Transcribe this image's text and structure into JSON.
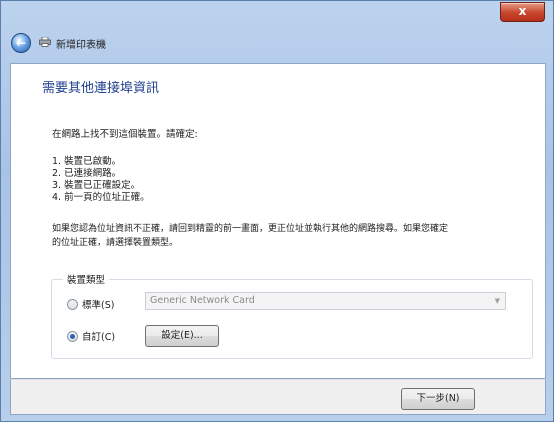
{
  "window": {
    "close_label": "x",
    "title": "新增印表機"
  },
  "main": {
    "heading": "需要其他連接埠資訊",
    "intro": "在網路上找不到這個裝置。請確定:",
    "checklist": [
      "1. 裝置已啟動。",
      "2. 已連接網路。",
      "3. 裝置已正確設定。",
      "4. 前一頁的位址正確。"
    ],
    "note_line1": "如果您認為位址資訊不正確，請回到精靈的前一畫面，更正位址並執行其他的網路搜尋。如果您確定",
    "note_line2": "的位址正確，請選擇裝置類型。"
  },
  "device_type": {
    "label": "裝置類型",
    "standard_label": "標準(S)",
    "standard_value": "Generic Network Card",
    "custom_label": "自訂(C)",
    "settings_button": "設定(E)..."
  },
  "footer": {
    "next_button": "下一步(N)"
  }
}
